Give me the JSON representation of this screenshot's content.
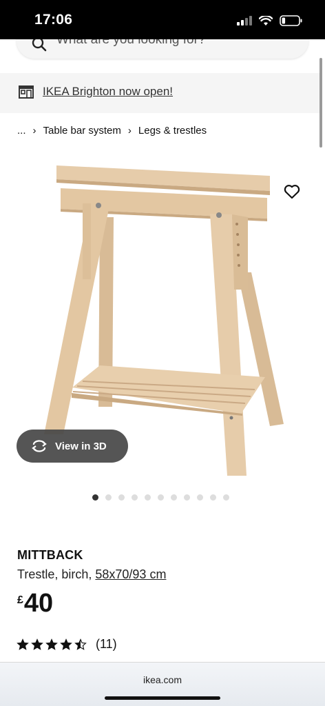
{
  "status_bar": {
    "time": "17:06",
    "battery_level": 0.2
  },
  "search": {
    "placeholder": "What are you looking for?"
  },
  "notice": {
    "text": "IKEA Brighton now open!"
  },
  "breadcrumb": {
    "items": [
      "...",
      "Table bar system",
      "Legs & trestles"
    ]
  },
  "gallery": {
    "view3d_label": "View in 3D",
    "image_count": 11,
    "active_index": 0
  },
  "product": {
    "name": "MITTBACK",
    "description": "Trestle, birch, ",
    "size": "58x70/93 cm",
    "currency": "£",
    "price": "40",
    "rating": 4.5,
    "rating_max": 5,
    "review_count": "(11)"
  },
  "browser": {
    "domain": "ikea.com"
  },
  "colors": {
    "wood": "#e3c9a7",
    "wood_dark": "#c9a982",
    "notice_bg": "#f5f5f5",
    "button_dark": "#464646"
  }
}
